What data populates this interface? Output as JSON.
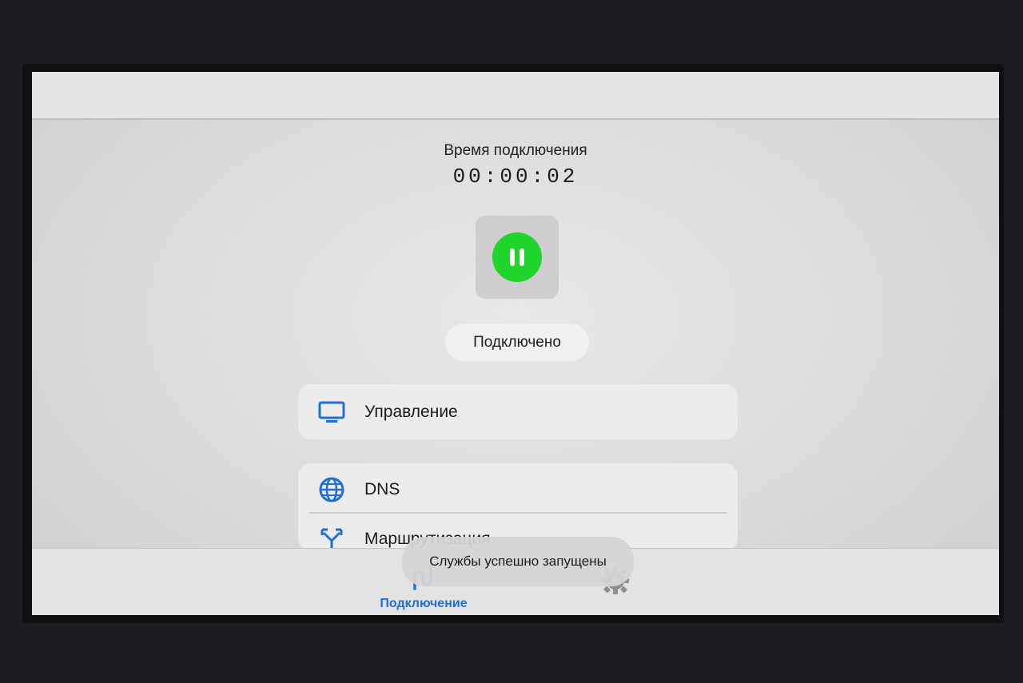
{
  "connection": {
    "time_label": "Время подключения",
    "time_value": "00:00:02",
    "status": "Подключено",
    "accent_color": "#1fd42a"
  },
  "menu": {
    "control_label": "Управление",
    "dns_label": "DNS",
    "routing_label": "Маршрутизация"
  },
  "bottom_nav": {
    "connection_label": "Подключение",
    "active_color": "#1e6fd6",
    "settings_icon": "gear-icon"
  },
  "toast": {
    "message": "Службы успешно запущены"
  },
  "icons": {
    "control": "tv-icon",
    "dns": "globe-icon",
    "routing": "fork-arrow-icon",
    "pause": "pause-icon",
    "connection_tab": "plug-icon"
  }
}
